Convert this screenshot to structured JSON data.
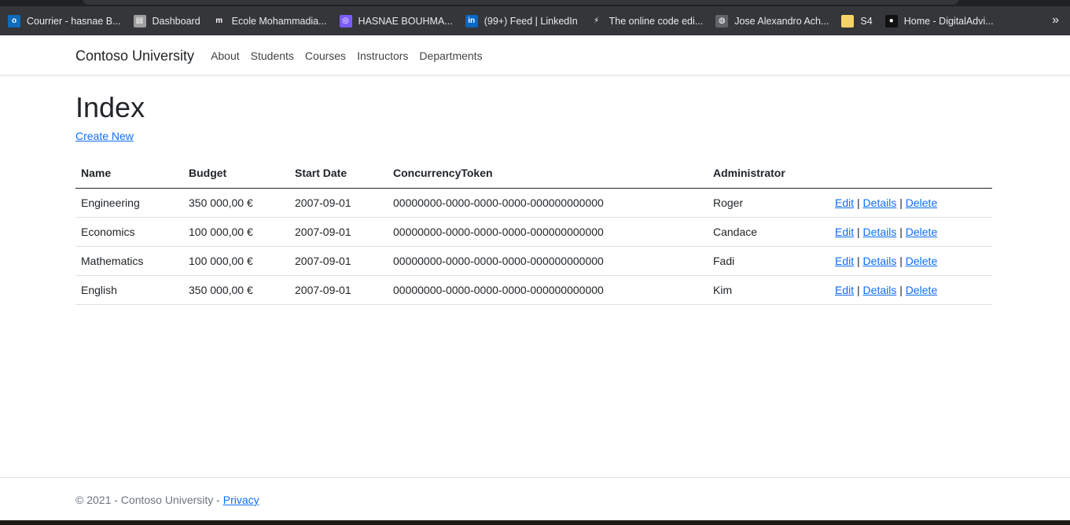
{
  "bookmarks": [
    {
      "label": "Courrier - hasnae B...",
      "icon": "outlook-icon",
      "color": "#0f6cbd",
      "glyph": "o"
    },
    {
      "label": "Dashboard",
      "icon": "dashboard-icon",
      "color": "#9e9e9e",
      "glyph": "▤"
    },
    {
      "label": "Ecole Mohammadia...",
      "icon": "moodle-icon",
      "color": "#35363a",
      "glyph": "m"
    },
    {
      "label": "HASNAE BOUHMA...",
      "icon": "hub-icon",
      "color": "#7b5cff",
      "glyph": "◎"
    },
    {
      "label": "(99+) Feed | LinkedIn",
      "icon": "linkedin-icon",
      "color": "#0a66c2",
      "glyph": "in"
    },
    {
      "label": "The online code edi...",
      "icon": "lightning-icon",
      "color": "#35363a",
      "glyph": "⚡"
    },
    {
      "label": "Jose Alexandro Ach...",
      "icon": "globe-icon",
      "color": "#5f6368",
      "glyph": "◍"
    },
    {
      "label": "S4",
      "icon": "folder-icon",
      "color": "#f6d365",
      "glyph": ""
    },
    {
      "label": "Home - DigitalAdvi...",
      "icon": "digital-icon",
      "color": "#111111",
      "glyph": "●"
    }
  ],
  "bookmarks_more": "»",
  "navbar": {
    "brand": "Contoso University",
    "links": [
      "About",
      "Students",
      "Courses",
      "Instructors",
      "Departments"
    ]
  },
  "page": {
    "title": "Index",
    "create_new": "Create New"
  },
  "table": {
    "headers": [
      "Name",
      "Budget",
      "Start Date",
      "ConcurrencyToken",
      "Administrator",
      ""
    ],
    "rows": [
      {
        "name": "Engineering",
        "budget": "350 000,00 €",
        "start_date": "2007-09-01",
        "token": "00000000-0000-0000-0000-000000000000",
        "admin": "Roger"
      },
      {
        "name": "Economics",
        "budget": "100 000,00 €",
        "start_date": "2007-09-01",
        "token": "00000000-0000-0000-0000-000000000000",
        "admin": "Candace"
      },
      {
        "name": "Mathematics",
        "budget": "100 000,00 €",
        "start_date": "2007-09-01",
        "token": "00000000-0000-0000-0000-000000000000",
        "admin": "Fadi"
      },
      {
        "name": "English",
        "budget": "350 000,00 €",
        "start_date": "2007-09-01",
        "token": "00000000-0000-0000-0000-000000000000",
        "admin": "Kim"
      }
    ],
    "actions": {
      "edit": "Edit",
      "details": "Details",
      "delete": "Delete",
      "sep": "|"
    }
  },
  "footer": {
    "copyright": "© 2021 - Contoso University - ",
    "privacy": "Privacy"
  }
}
